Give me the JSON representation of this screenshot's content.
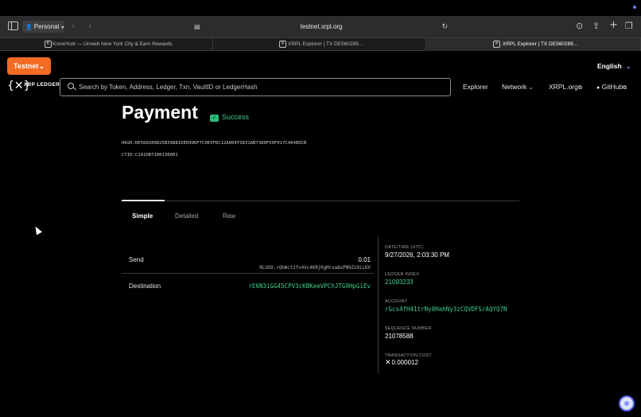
{
  "browser": {
    "profile": "Personal",
    "url": "testnet.xrpl.org",
    "tabs": [
      {
        "title": "KnowYork — Unweb New York City & Earn Rewards"
      },
      {
        "title": "XRPL Explorer | TX DE560289..."
      },
      {
        "title": "XRPL Explorer | TX DE560289..."
      }
    ]
  },
  "header": {
    "network_button": "Testnet",
    "language": "English",
    "logo_text": "XRP LEDGER",
    "search_placeholder": "Search by Token, Address, Ledger, Txn, VaultID or LedgerHash",
    "nav": {
      "explorer": "Explorer",
      "network": "Network",
      "xrpl_org": "XRPL.org",
      "github": "GitHub"
    }
  },
  "transaction": {
    "type": "Payment",
    "status": "Success",
    "hash_label": "HASH:",
    "hash": "DE560289D25B39881EED906F7C0E5FDC12A804T3831AB7380F59F017C464DDCB",
    "ctid_label": "CTID:",
    "ctid": "C141DB7100130001",
    "tabs": [
      "Simple",
      "Detailed",
      "Raw"
    ],
    "send_label": "Send",
    "send_amount": "0.01",
    "send_currency": "RLUSD.rQhWct2fv4Vc4KRjRgMrxa8xPN9Zx9iLKV",
    "destination_label": "Destination",
    "destination": "rE6N3iGG45CPV3cKBKeeVPChJTG9HpGiEv",
    "details": {
      "datetime_label": "DATE/TIME (UTC)",
      "datetime": "9/27/2026, 2:03:30 PM",
      "ledger_label": "LEDGER INDEX",
      "ledger": "21093233",
      "account_label": "ACCOUNT",
      "account": "rGcs4fH41trNy8HahNy3zCQVDFSrAQYQ7N",
      "sequence_label": "SEQUENCE NUMBER",
      "sequence": "21078588",
      "fee_label": "TRANSACTION COST",
      "fee": "0.000012"
    }
  }
}
